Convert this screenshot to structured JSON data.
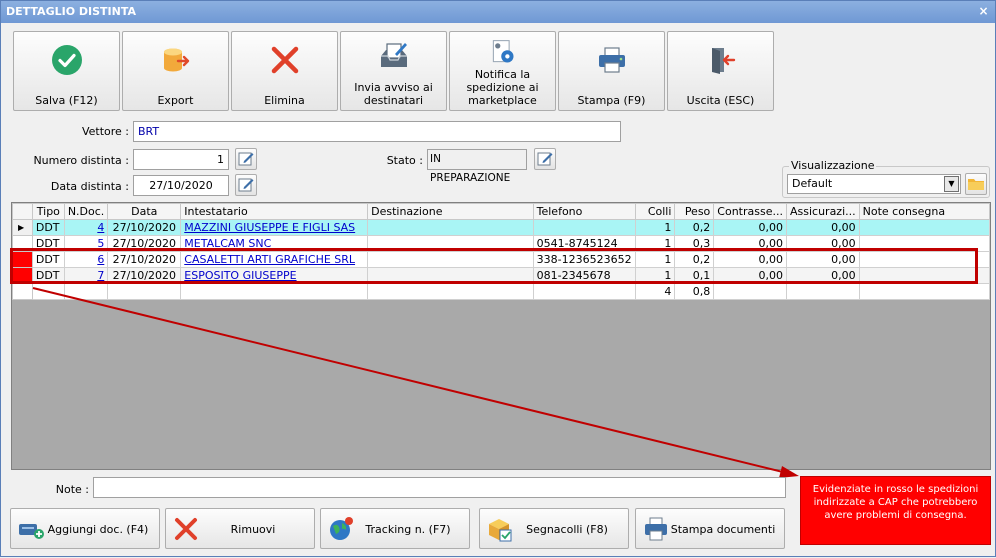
{
  "window": {
    "title": "DETTAGLIO DISTINTA",
    "close_glyph": "×"
  },
  "toolbar": [
    {
      "label": "Salva (F12)",
      "icon": "check-icon"
    },
    {
      "label": "Export",
      "icon": "export-icon"
    },
    {
      "label": "Elimina",
      "icon": "delete-x-icon"
    },
    {
      "label": "Invia avviso ai destinatari",
      "icon": "send-notice-icon"
    },
    {
      "label": "Notifica la spedizione ai marketplace",
      "icon": "notify-gear-icon"
    },
    {
      "label": "Stampa (F9)",
      "icon": "printer-icon"
    },
    {
      "label": "Uscita (ESC)",
      "icon": "exit-door-icon"
    }
  ],
  "form": {
    "vettore_label": "Vettore :",
    "vettore_value": "BRT",
    "numero_label": "Numero distinta :",
    "numero_value": "1",
    "data_label": "Data distinta :",
    "data_value": "27/10/2020",
    "stato_label": "Stato :",
    "stato_value": "IN PREPARAZIONE"
  },
  "visualizzazione": {
    "label": "Visualizzazione",
    "value": "Default"
  },
  "grid": {
    "columns": [
      "Tipo",
      "N.Doc.",
      "Data",
      "Intestatario",
      "Destinazione",
      "Telefono",
      "Colli",
      "Peso",
      "Contrasse...",
      "Assicurazi...",
      "Note consegna"
    ],
    "rows": [
      {
        "tipo": "DDT",
        "ndoc": "4",
        "data": "27/10/2020",
        "intestatario": "MAZZINI GIUSEPPE E FIGLI SAS",
        "destinazione": "",
        "telefono": "",
        "colli": "1",
        "peso": "0,2",
        "contrassegno": "0,00",
        "assicurazione": "0,00",
        "note": ""
      },
      {
        "tipo": "DDT",
        "ndoc": "5",
        "data": "27/10/2020",
        "intestatario": "METALCAM SNC",
        "destinazione": "",
        "telefono": "0541-8745124",
        "colli": "1",
        "peso": "0,3",
        "contrassegno": "0,00",
        "assicurazione": "0,00",
        "note": ""
      },
      {
        "tipo": "DDT",
        "ndoc": "6",
        "data": "27/10/2020",
        "intestatario": "CASALETTI ARTI GRAFICHE SRL",
        "destinazione": "",
        "telefono": "338-1236523652",
        "colli": "1",
        "peso": "0,2",
        "contrassegno": "0,00",
        "assicurazione": "0,00",
        "note": ""
      },
      {
        "tipo": "DDT",
        "ndoc": "7",
        "data": "27/10/2020",
        "intestatario": "ESPOSITO GIUSEPPE",
        "destinazione": "",
        "telefono": "081-2345678",
        "colli": "1",
        "peso": "0,1",
        "contrassegno": "0,00",
        "assicurazione": "0,00",
        "note": ""
      }
    ],
    "totals": {
      "colli": "4",
      "peso": "0,8"
    }
  },
  "note": {
    "label": "Note :",
    "value": ""
  },
  "callout_text": "Evidenziate in rosso le spedizioni indirizzate a CAP che potrebbero avere problemi di consegna.",
  "bottom_buttons": [
    {
      "label": "Aggiungi doc. (F4)",
      "icon": "add-document-icon"
    },
    {
      "label": "Rimuovi",
      "icon": "remove-x-icon"
    },
    {
      "label": "Tracking n. (F7)",
      "icon": "globe-icon"
    },
    {
      "label": "Segnacolli (F8)",
      "icon": "package-labels-icon"
    },
    {
      "label": "Stampa documenti",
      "icon": "printer-icon"
    }
  ],
  "colors": {
    "highlight_row": "#a9f5f5",
    "warning_red": "#ff0000",
    "link": "#0000cc"
  }
}
